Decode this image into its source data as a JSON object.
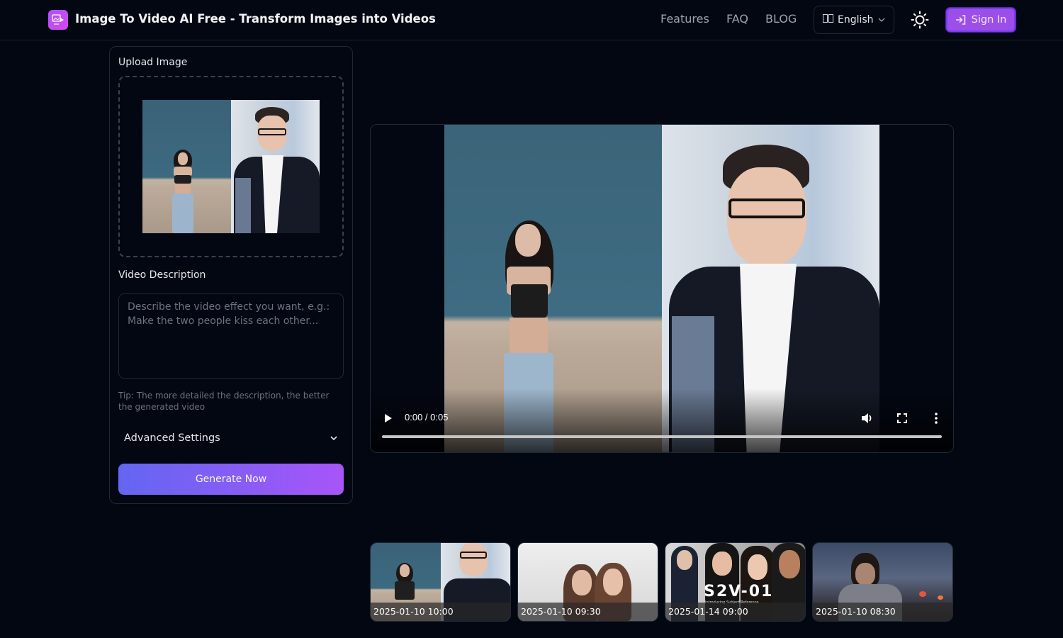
{
  "header": {
    "title": "Image To Video AI Free - Transform Images into Videos",
    "logo_icon": "image-to-video-icon",
    "nav": [
      {
        "label": "Features"
      },
      {
        "label": "FAQ"
      },
      {
        "label": "BLOG"
      }
    ],
    "language": {
      "flag_icon": "flag-icon",
      "label": "English",
      "chevron_icon": "chevron-down-icon"
    },
    "theme_toggle_icon": "sun-icon",
    "signin": {
      "label": "Sign In",
      "icon": "sign-in-icon"
    }
  },
  "colors": {
    "background": "#030712",
    "accent_start": "#6366f1",
    "accent_end": "#a855f7",
    "signin": "#9b4fe8"
  },
  "form": {
    "upload_label": "Upload Image",
    "uploaded_image_alt": "Two portraits: woman in front of blue wall, man in glasses and blazer",
    "description_label": "Video Description",
    "description_value": "",
    "description_placeholder": "Describe the video effect you want, e.g.: Make the two people kiss each other...",
    "tip": "Tip: The more detailed the description, the better the generated video",
    "advanced_label": "Advanced Settings",
    "generate_label": "Generate Now"
  },
  "video": {
    "time": "0:00 / 0:05",
    "progress_fraction": 0,
    "play_icon": "play-icon",
    "volume_icon": "volume-icon",
    "fullscreen_icon": "fullscreen-icon",
    "more_icon": "more-vertical-icon"
  },
  "gallery": [
    {
      "timestamp": "2025-01-10 10:00",
      "scene": "woman and man portraits"
    },
    {
      "timestamp": "2025-01-10 09:30",
      "scene": "two women smiling"
    },
    {
      "timestamp": "2025-01-14 09:00",
      "scene": "S2V-01 group portrait",
      "overlay_title": "S2V-01",
      "overlay_subtitle": "Introducing Subject Reference"
    },
    {
      "timestamp": "2025-01-10 08:30",
      "scene": "armored child on battlefield"
    }
  ]
}
